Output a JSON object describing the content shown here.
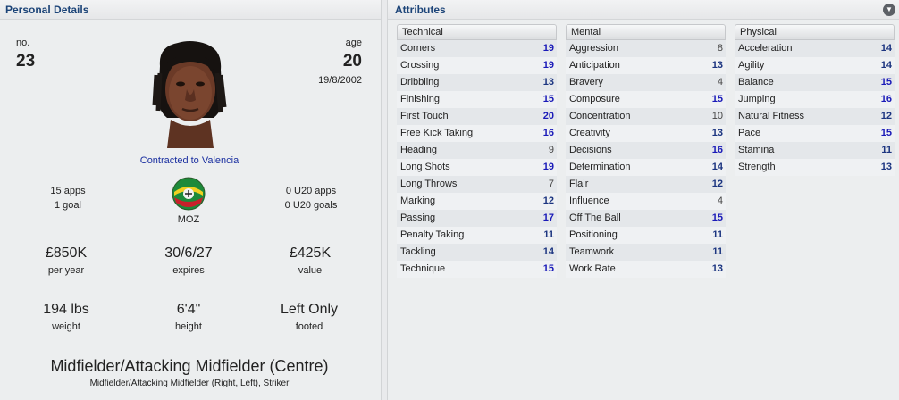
{
  "personal": {
    "title": "Personal Details",
    "no_label": "no.",
    "no_value": "23",
    "age_label": "age",
    "age_value": "20",
    "dob": "19/8/2002",
    "contract": "Contracted to Valencia",
    "apps": "15 apps",
    "goals": "1 goal",
    "nation": "MOZ",
    "u20_apps": "0 U20 apps",
    "u20_goals": "0 U20 goals",
    "wage_value": "£850K",
    "wage_label": "per year",
    "expires_value": "30/6/27",
    "expires_label": "expires",
    "value_value": "£425K",
    "value_label": "value",
    "weight_value": "194 lbs",
    "weight_label": "weight",
    "height_value": "6'4\"",
    "height_label": "height",
    "foot_value": "Left Only",
    "foot_label": "footed",
    "position_main": "Midfielder/Attacking Midfielder (Centre)",
    "position_sub": "Midfielder/Attacking Midfielder (Right, Left), Striker"
  },
  "attributes": {
    "title": "Attributes",
    "menu_icon": "chevron-down-icon",
    "columns": [
      {
        "heading": "Technical",
        "rows": [
          {
            "name": "Corners",
            "value": "19"
          },
          {
            "name": "Crossing",
            "value": "19"
          },
          {
            "name": "Dribbling",
            "value": "13"
          },
          {
            "name": "Finishing",
            "value": "15"
          },
          {
            "name": "First Touch",
            "value": "20"
          },
          {
            "name": "Free Kick Taking",
            "value": "16"
          },
          {
            "name": "Heading",
            "value": "9"
          },
          {
            "name": "Long Shots",
            "value": "19"
          },
          {
            "name": "Long Throws",
            "value": "7"
          },
          {
            "name": "Marking",
            "value": "12"
          },
          {
            "name": "Passing",
            "value": "17"
          },
          {
            "name": "Penalty Taking",
            "value": "11"
          },
          {
            "name": "Tackling",
            "value": "14"
          },
          {
            "name": "Technique",
            "value": "15"
          }
        ]
      },
      {
        "heading": "Mental",
        "rows": [
          {
            "name": "Aggression",
            "value": "8"
          },
          {
            "name": "Anticipation",
            "value": "13"
          },
          {
            "name": "Bravery",
            "value": "4"
          },
          {
            "name": "Composure",
            "value": "15"
          },
          {
            "name": "Concentration",
            "value": "10"
          },
          {
            "name": "Creativity",
            "value": "13"
          },
          {
            "name": "Decisions",
            "value": "16"
          },
          {
            "name": "Determination",
            "value": "14"
          },
          {
            "name": "Flair",
            "value": "12"
          },
          {
            "name": "Influence",
            "value": "4"
          },
          {
            "name": "Off The Ball",
            "value": "15"
          },
          {
            "name": "Positioning",
            "value": "11"
          },
          {
            "name": "Teamwork",
            "value": "11"
          },
          {
            "name": "Work Rate",
            "value": "13"
          }
        ]
      },
      {
        "heading": "Physical",
        "rows": [
          {
            "name": "Acceleration",
            "value": "14"
          },
          {
            "name": "Agility",
            "value": "14"
          },
          {
            "name": "Balance",
            "value": "15"
          },
          {
            "name": "Jumping",
            "value": "16"
          },
          {
            "name": "Natural Fitness",
            "value": "12"
          },
          {
            "name": "Pace",
            "value": "15"
          },
          {
            "name": "Stamina",
            "value": "11"
          },
          {
            "name": "Strength",
            "value": "13"
          }
        ]
      }
    ]
  }
}
